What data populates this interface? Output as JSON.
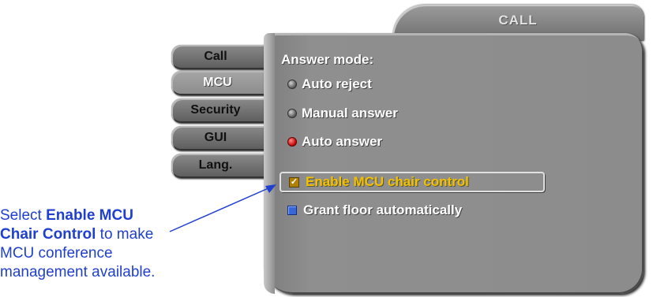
{
  "window": {
    "title": "CALL"
  },
  "tabs": [
    {
      "label": "Call",
      "active": false
    },
    {
      "label": "MCU",
      "active": true
    },
    {
      "label": "Security",
      "active": false
    },
    {
      "label": "GUI",
      "active": false
    },
    {
      "label": "Lang.",
      "active": false
    }
  ],
  "answer_mode": {
    "heading": "Answer mode:",
    "options": [
      {
        "label": "Auto reject",
        "selected": false
      },
      {
        "label": "Manual answer",
        "selected": false
      },
      {
        "label": "Auto answer",
        "selected": true
      }
    ]
  },
  "checkboxes": {
    "chair_control": {
      "label": "Enable MCU chair control",
      "checked": true
    },
    "grant_floor": {
      "label": "Grant floor automatically",
      "checked": false
    }
  },
  "annotation": {
    "line1_prefix": "Select ",
    "line1_bold": "Enable MCU",
    "line2_bold": "Chair Control",
    "line2_suffix": " to make",
    "line3": "MCU conference",
    "line4": "management available."
  },
  "colors": {
    "accent_selected_text": "#f5c000",
    "radio_on": "#c40000",
    "annotation_text": "#1f3fcf"
  }
}
